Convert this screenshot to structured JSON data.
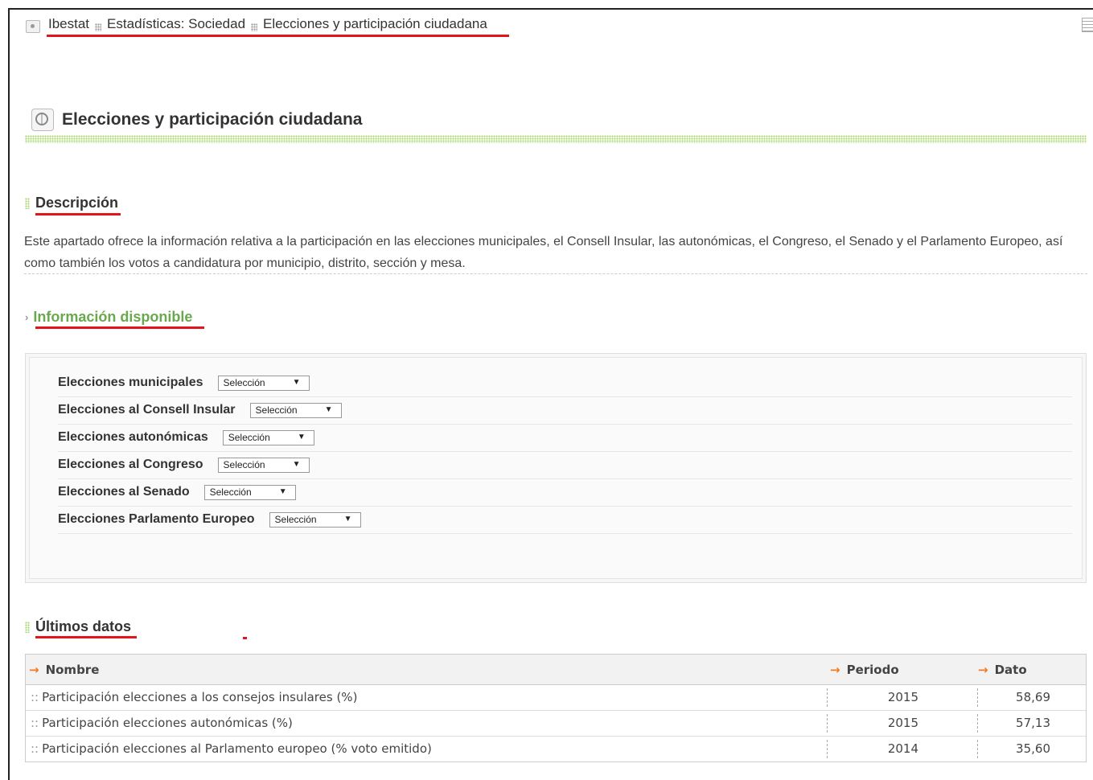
{
  "breadcrumb": {
    "items": [
      "Ibestat",
      "Estadísticas: Sociedad",
      "Elecciones y participación ciudadana"
    ]
  },
  "page_title": "Elecciones y participación ciudadana",
  "descripcion": {
    "heading": "Descripción",
    "text": "Este apartado ofrece la información relativa a la participación en las elecciones municipales, el Consell Insular, las autonómicas, el Congreso, el Senado y el Parlamento Europeo, así como también los votos a candidatura por municipio, distrito, sección y mesa."
  },
  "informacion": {
    "heading": "Información disponible",
    "rows": [
      {
        "label": "Elecciones municipales",
        "select": "Selección"
      },
      {
        "label": "Elecciones al Consell Insular",
        "select": "Selección"
      },
      {
        "label": "Elecciones autonómicas",
        "select": "Selección"
      },
      {
        "label": "Elecciones al Congreso",
        "select": "Selección"
      },
      {
        "label": "Elecciones al Senado",
        "select": "Selección"
      },
      {
        "label": "Elecciones Parlamento Europeo",
        "select": "Selección"
      }
    ]
  },
  "ultimos": {
    "heading": "Últimos datos",
    "columns": [
      "Nombre",
      "Periodo",
      "Dato"
    ],
    "rows": [
      {
        "nombre": "Participación elecciones a los consejos insulares (%)",
        "periodo": "2015",
        "dato": "58,69"
      },
      {
        "nombre": "Participación elecciones autonómicas (%)",
        "periodo": "2015",
        "dato": "57,13"
      },
      {
        "nombre": "Participación elecciones al Parlamento europeo (% voto emitido)",
        "periodo": "2014",
        "dato": "35,60"
      }
    ]
  },
  "colors": {
    "accent_green": "#a9d46d",
    "link_green": "#6aa84f",
    "annotation_red": "#e0161b",
    "table_arrow_orange": "#f47a20"
  }
}
